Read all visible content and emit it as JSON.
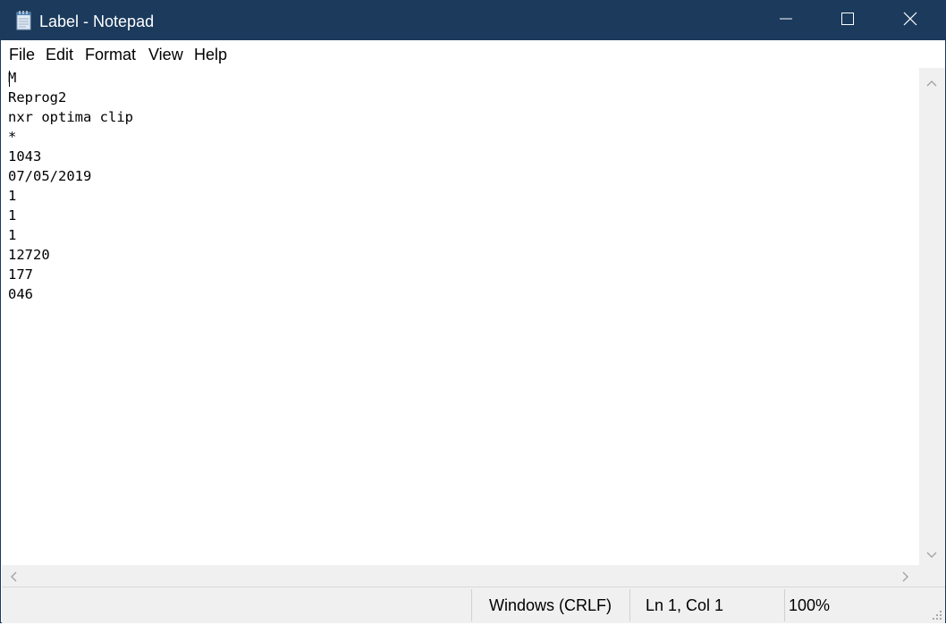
{
  "window": {
    "title": "Label - Notepad"
  },
  "menu": {
    "items": [
      "File",
      "Edit",
      "Format",
      "View",
      "Help"
    ]
  },
  "editor": {
    "lines": [
      "M",
      "Reprog2",
      "nxr optima clip",
      "*",
      "1043",
      "07/05/2019",
      "1",
      "1",
      "1",
      "12720",
      "177",
      "046"
    ]
  },
  "statusbar": {
    "line_ending": "Windows (CRLF)",
    "position": "Ln 1, Col 1",
    "zoom": "100%"
  },
  "icons": {
    "app": "notepad-icon",
    "minimize": "minimize-icon",
    "maximize": "maximize-icon",
    "close": "close-icon"
  },
  "colors": {
    "titlebar": "#1b3a5c",
    "statusbar": "#f0f0f0"
  }
}
